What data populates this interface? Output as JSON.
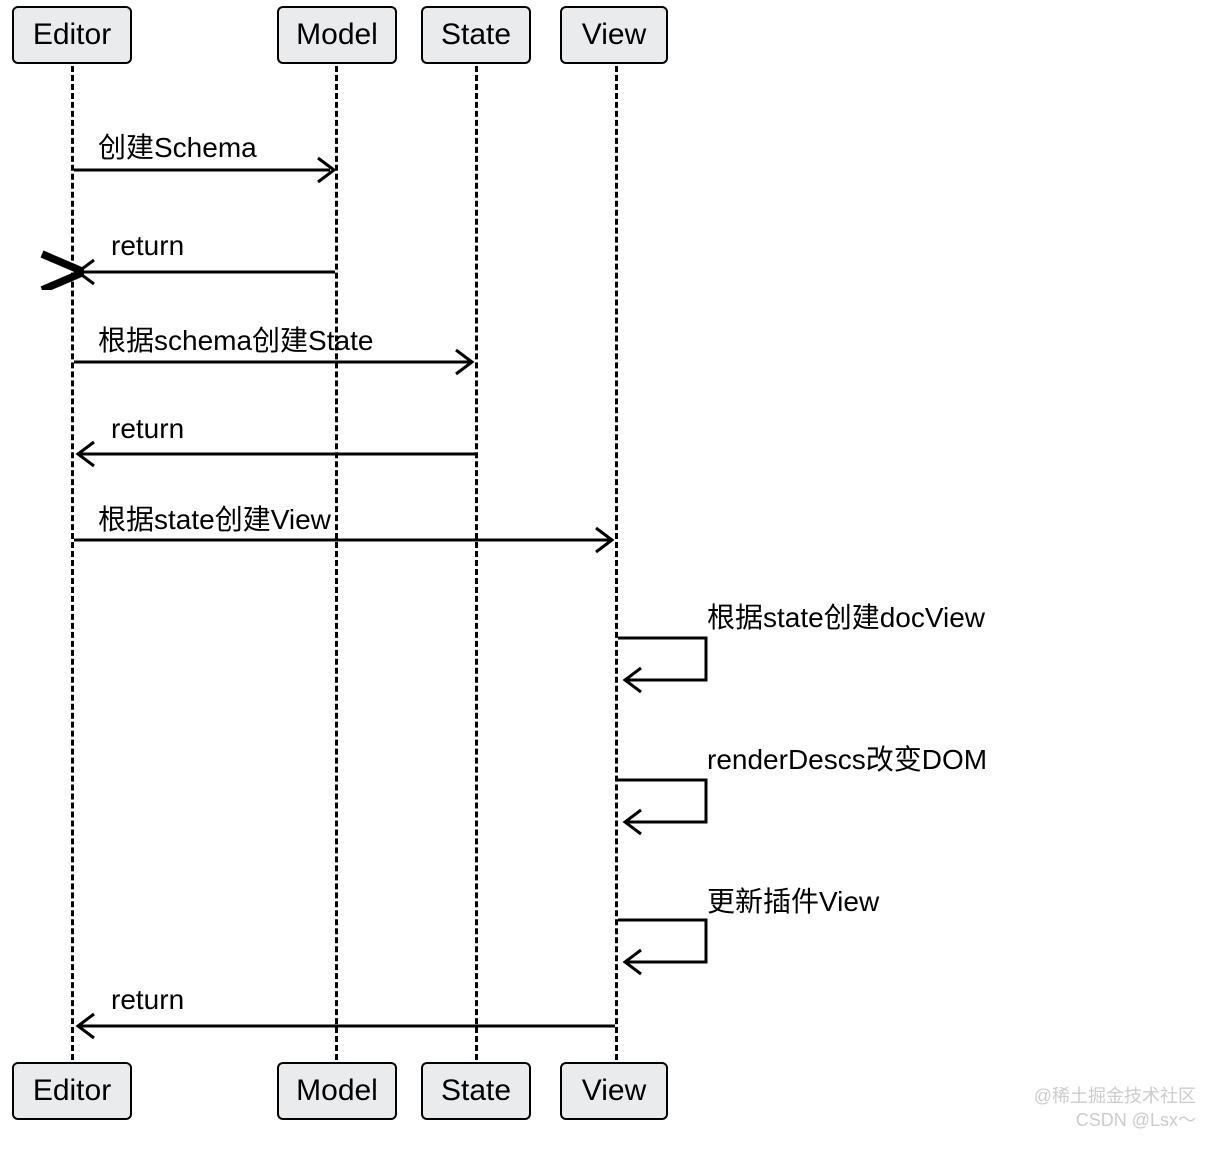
{
  "participants": {
    "editor": "Editor",
    "model": "Model",
    "state": "State",
    "view": "View"
  },
  "messages": {
    "m1": "创建Schema",
    "m2": "return",
    "m3": "根据schema创建State",
    "m4": "return",
    "m5": "根据state创建View",
    "m6": "根据state创建docView",
    "m7": "renderDescs改变DOM",
    "m8": "更新插件View",
    "m9": "return"
  },
  "watermark": {
    "line1": "@稀土掘金技术社区",
    "line2": "CSDN @Lsx～"
  }
}
